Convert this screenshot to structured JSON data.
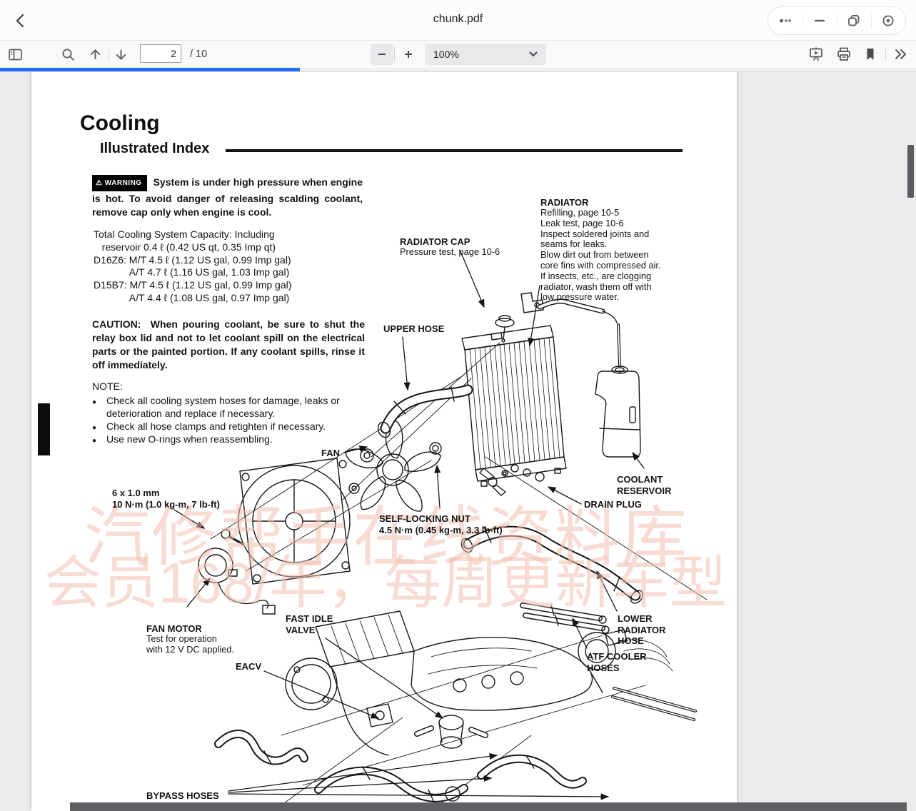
{
  "window": {
    "title": "chunk.pdf"
  },
  "pdf_toolbar": {
    "page_value": "2",
    "page_total": "/ 10",
    "zoom_value": "100%"
  },
  "icons": {
    "bullet": "●",
    "warning_triangle": "⚠"
  },
  "colors": {
    "accent_blue": "#1b6ef3",
    "scroll_thumb": "#5a5a60",
    "watermark_pink": "#f4bfae"
  },
  "document": {
    "title": "Cooling",
    "subtitle": "Illustrated Index",
    "warning_label": "WARNING",
    "warning_text": "System is under high pressure when engine is hot. To avoid danger of releasing scalding coolant, remove cap only when engine is cool.",
    "capacity_block": "Total Cooling System Capacity: Including\n   reservoir 0.4 ℓ (0.42 US qt, 0.35 Imp qt)\nD16Z6: M/T 4.5 ℓ (1.12 US gal, 0.99 Imp gal)\n             A/T 4.7 ℓ (1.16 US gal, 1.03 Imp gal)\nD15B7: M/T 4.5 ℓ (1.12 US gal, 0.99 Imp gal)\n             A/T 4.4 ℓ (1.08 US gal, 0.97 Imp gal)",
    "caution_label": "CAUTION:",
    "caution_text": "When pouring coolant, be sure to shut the relay box lid and not to let coolant spill on the electrical parts or the painted portion. If any coolant spills, rinse it off immediately.",
    "note_label": "NOTE:",
    "notes": [
      "Check all cooling system hoses for damage, leaks or deterioration and replace if necessary.",
      "Check all hose clamps and retighten if necessary.",
      "Use new O-rings when reassembling."
    ],
    "labels": {
      "radiator_cap": {
        "title": "RADIATOR CAP",
        "sub": "Pressure test, page 10-6"
      },
      "radiator": {
        "title": "RADIATOR",
        "sub": "Refilling, page 10-5\nLeak test, page 10-6\nInspect soldered joints and\nseams for leaks.\nBlow dirt out from between\ncore fins with compressed air.\nIf insects, etc., are clogging\nradiator, wash them off with\nlow pressure water."
      },
      "upper_hose": {
        "title": "UPPER HOSE"
      },
      "fan": {
        "title": "FAN"
      },
      "bolt_spec": {
        "title": "6 x 1.0 mm\n10 N·m (1.0 kg-m, 7 lb-ft)"
      },
      "self_locking_nut": {
        "title": "SELF-LOCKING NUT\n4.5 N·m (0.45 kg-m, 3.3 lb-ft)"
      },
      "drain_plug": {
        "title": "DRAIN PLUG"
      },
      "coolant_reservoir": {
        "title": "COOLANT\nRESERVOIR"
      },
      "fan_motor": {
        "title": "FAN MOTOR",
        "sub": "Test for operation\nwith 12 V DC applied."
      },
      "fast_idle_valve": {
        "title": "FAST IDLE\nVALVE"
      },
      "eacv": {
        "title": "EACV"
      },
      "lower_radiator_hose": {
        "title": "LOWER\nRADIATOR\nHOSE"
      },
      "atf_cooler_hoses": {
        "title": "ATF COOLER\nHOSES"
      },
      "bypass_hoses": {
        "title": "BYPASS HOSES"
      }
    },
    "watermarks": {
      "line1": "汽修帮手在线资料库",
      "line2": "会员168/年，每周更新车型"
    }
  }
}
